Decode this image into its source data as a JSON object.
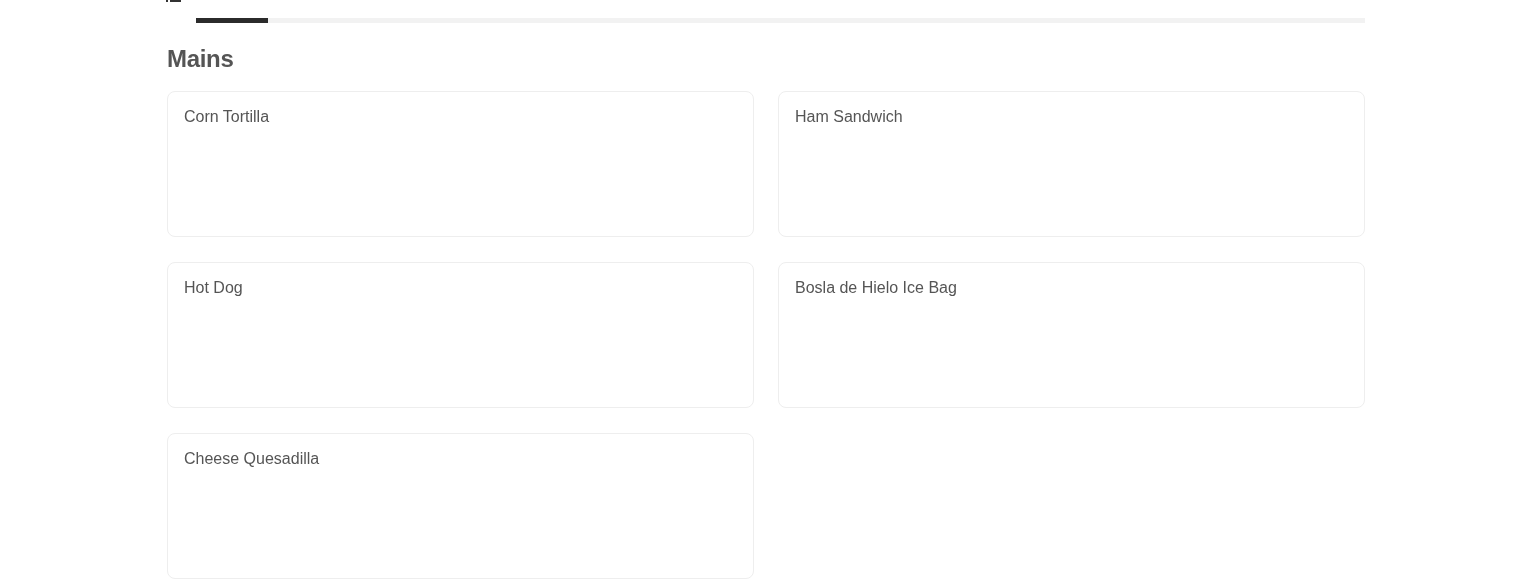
{
  "category_progress": {
    "level": 0.062
  },
  "section": {
    "title": "Mains"
  },
  "items": [
    {
      "name": "Corn Tortilla"
    },
    {
      "name": "Ham Sandwich"
    },
    {
      "name": "Hot Dog"
    },
    {
      "name": "Bosla de Hielo Ice Bag"
    },
    {
      "name": "Cheese Quesadilla"
    }
  ]
}
